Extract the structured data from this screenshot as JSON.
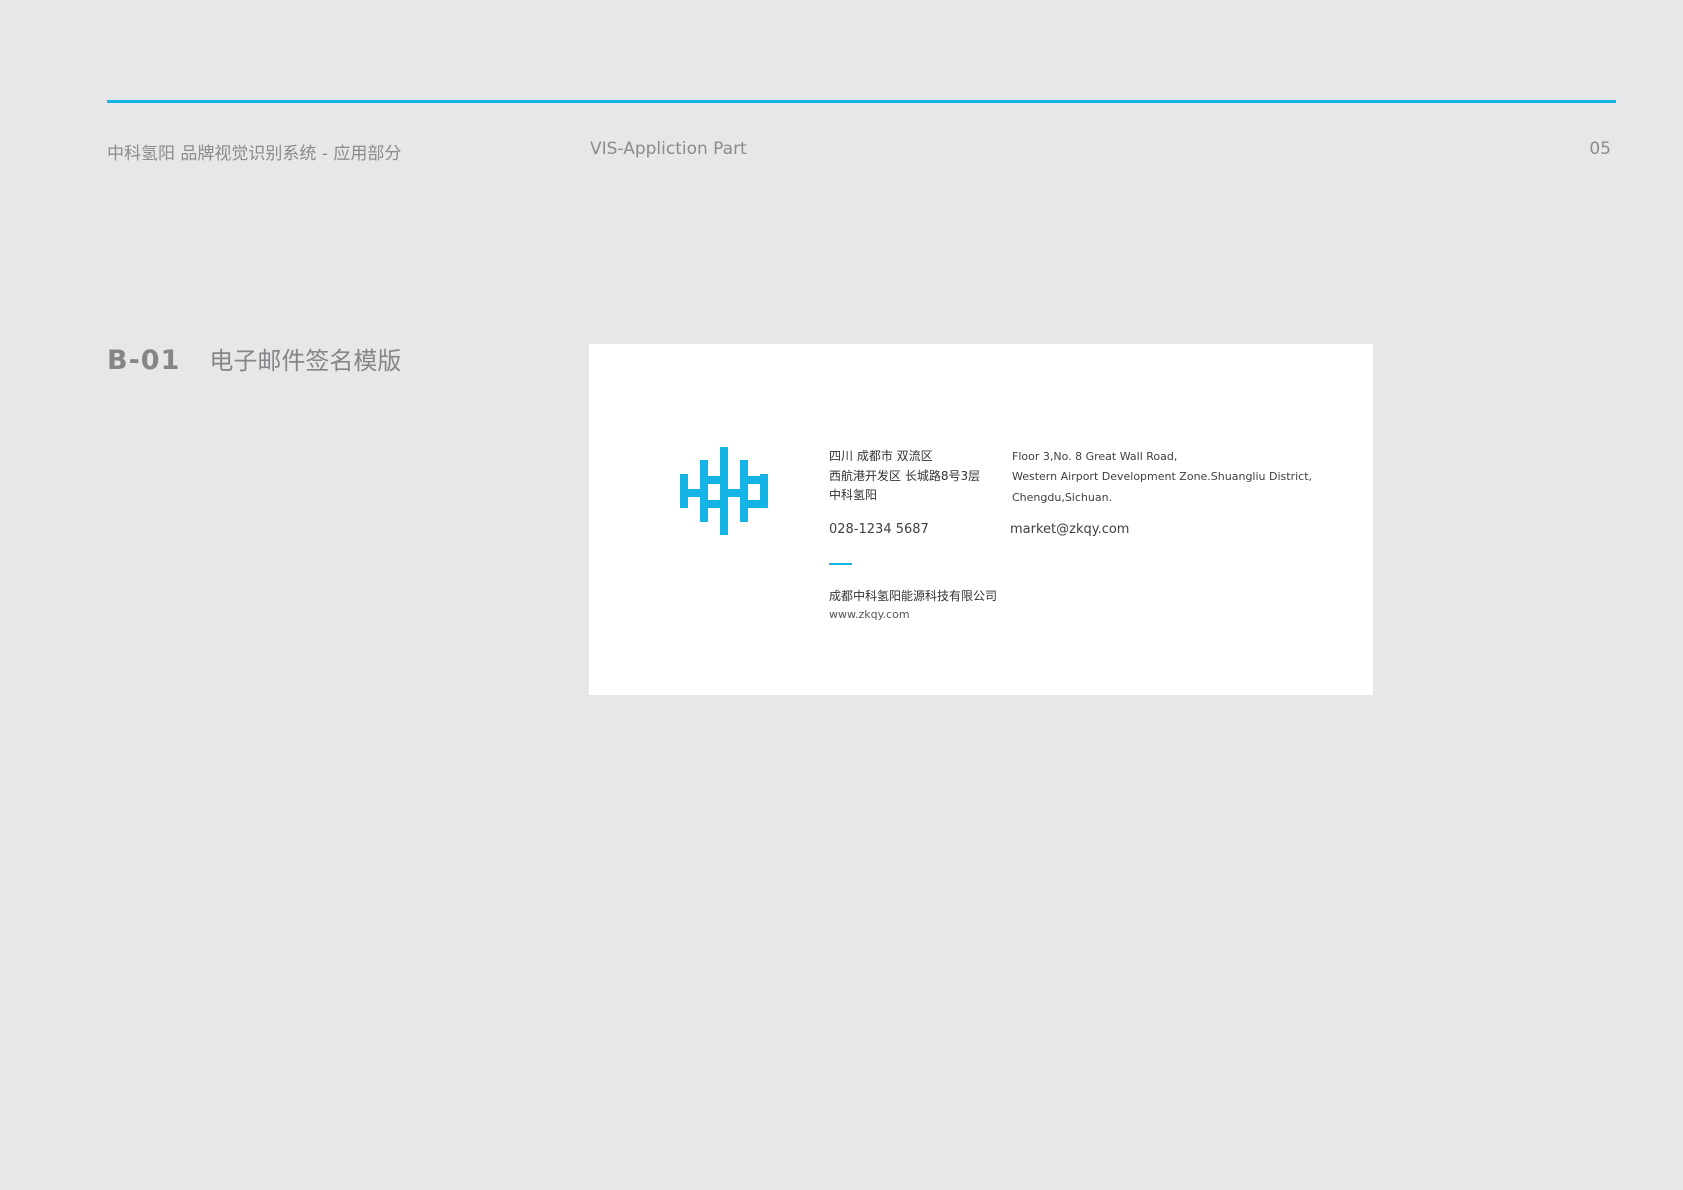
{
  "header": {
    "left_title": "中科氢阳  品牌视觉识别系统 - 应用部分",
    "center_title": "VIS-Appliction Part",
    "page_number": "05"
  },
  "section": {
    "code": "B-01",
    "name": "电子邮件签名模版"
  },
  "signature": {
    "cn_address": [
      "四川 成都市 双流区",
      "西航港开发区 长城路8号3层",
      "中科氢阳"
    ],
    "en_address": [
      "Floor 3,No. 8 Great Wall Road,",
      "Western Airport Development Zone.Shuangliu District,",
      "Chengdu,Sichuan."
    ],
    "phone": "028-1234 5687",
    "email": "market@zkqy.com",
    "company": "成都中科氢阳能源科技有限公司",
    "website": "www.zkqy.com"
  },
  "colors": {
    "accent": "#14b4e6",
    "background": "#e6e7e9",
    "card": "#ffffff"
  },
  "icons": {
    "logo": "zkqy-brand-logo"
  }
}
